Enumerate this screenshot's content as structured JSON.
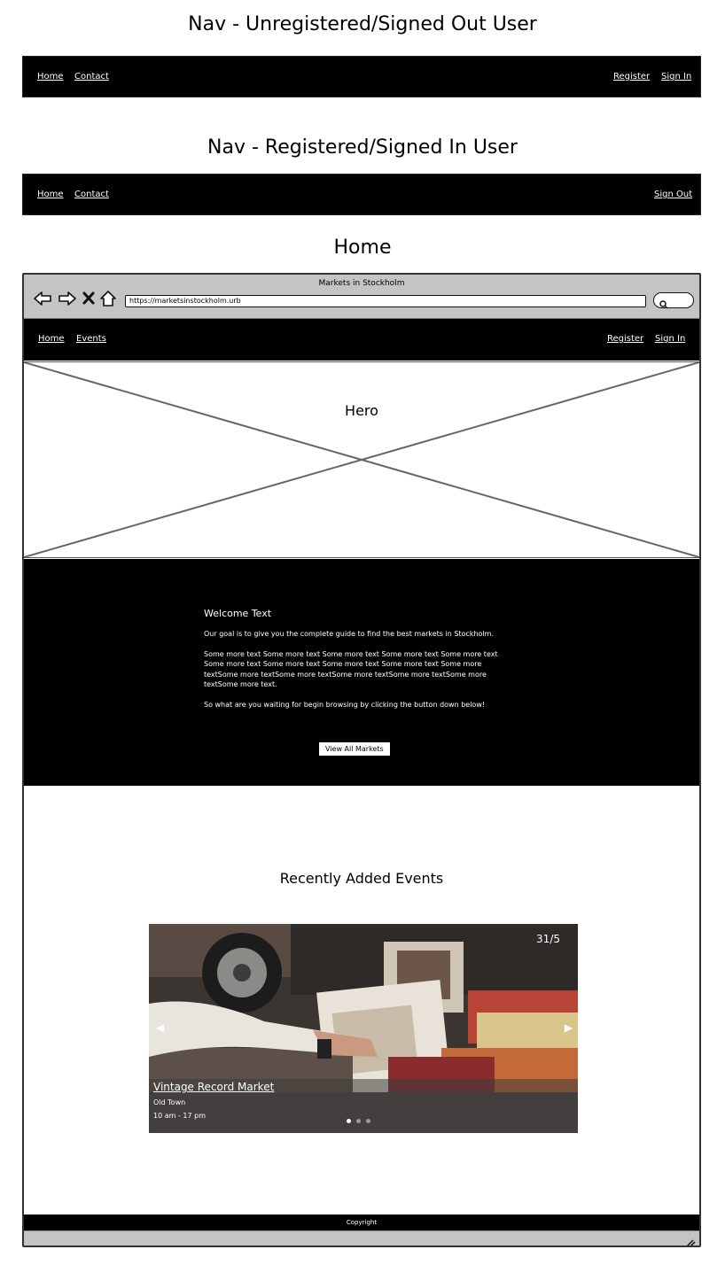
{
  "sections": {
    "signed_out_title": "Nav - Unregistered/Signed Out User",
    "signed_in_title": "Nav - Registered/Signed In User",
    "home_title": "Home"
  },
  "nav_signed_out": {
    "left": [
      "Home",
      "Contact"
    ],
    "right": [
      "Register",
      "Sign In"
    ]
  },
  "nav_signed_in": {
    "left": [
      "Home",
      "Contact"
    ],
    "right": [
      "Sign Out"
    ]
  },
  "browser": {
    "title": "Markets in Stockholm",
    "url": "https://marketsinstockholm.urb",
    "icons": [
      "back-arrow-icon",
      "forward-arrow-icon",
      "stop-icon",
      "home-icon",
      "search-icon"
    ]
  },
  "site_nav": {
    "left": [
      "Home",
      "Events"
    ],
    "right": [
      "Register",
      "Sign In"
    ]
  },
  "hero": {
    "label": "Hero"
  },
  "welcome": {
    "heading": "Welcome Text",
    "para1": "Our goal is to give you the complete guide to find the best markets in Stockholm.",
    "para2": "Some more text Some more text Some more text Some more text Some more text Some more text Some more text Some more text Some more text Some more textSome more textSome more textSome more textSome more textSome more textSome more text.",
    "para3": "So what are you waiting for begin browsing by clicking the button down below!",
    "button": "View All Markets"
  },
  "events": {
    "title": "Recently Added Events",
    "slide": {
      "date": "31/5",
      "name": "Vintage Record Market",
      "location": "Old Town",
      "time": "10 am - 17 pm"
    },
    "slide_count": 3,
    "active_slide": 1
  },
  "footer": {
    "text": "Copyright"
  }
}
